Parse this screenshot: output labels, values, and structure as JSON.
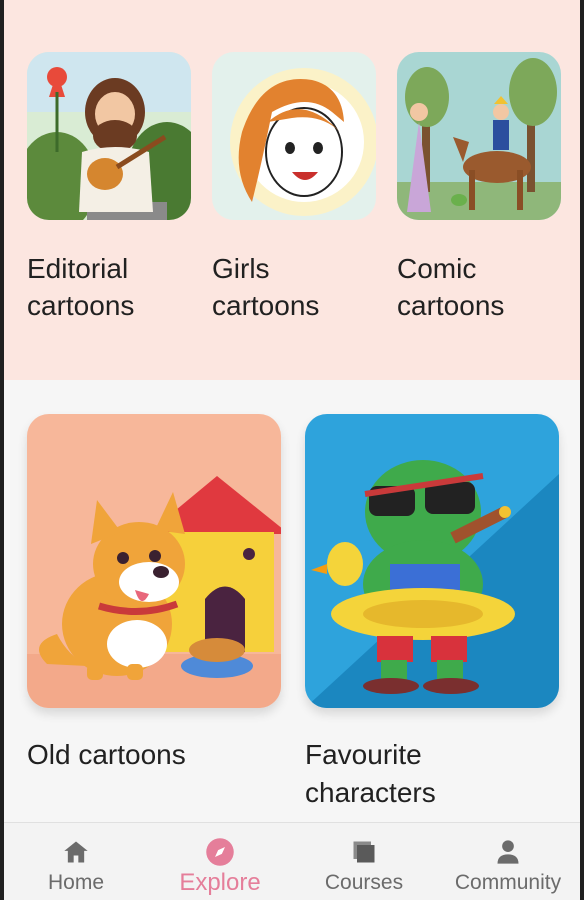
{
  "categories_top": [
    {
      "label_line1": "Editorial",
      "label_line2": "cartoons",
      "image": "bearded-man-guitar-illustration"
    },
    {
      "label_line1": "Girls",
      "label_line2": "cartoons",
      "image": "girl-face-sun-illustration"
    },
    {
      "label_line1": "Comic",
      "label_line2": "cartoons",
      "image": "prince-horse-princess-illustration"
    }
  ],
  "categories_bottom": [
    {
      "label_line1": "Old cartoons",
      "label_line2": "",
      "image": "dog-doghouse-illustration"
    },
    {
      "label_line1": "Favourite",
      "label_line2": "characters",
      "image": "frog-sunglasses-illustration"
    }
  ],
  "bottom_nav": {
    "items": [
      {
        "label": "Home",
        "icon": "home-icon",
        "active": false
      },
      {
        "label": "Explore",
        "icon": "compass-icon",
        "active": true
      },
      {
        "label": "Courses",
        "icon": "stack-icon",
        "active": false
      },
      {
        "label": "Community",
        "icon": "person-icon",
        "active": false
      }
    ]
  },
  "colors": {
    "top_background": "#fce6e0",
    "accent": "#e57e9a",
    "nav_inactive": "#6b6b6b"
  }
}
